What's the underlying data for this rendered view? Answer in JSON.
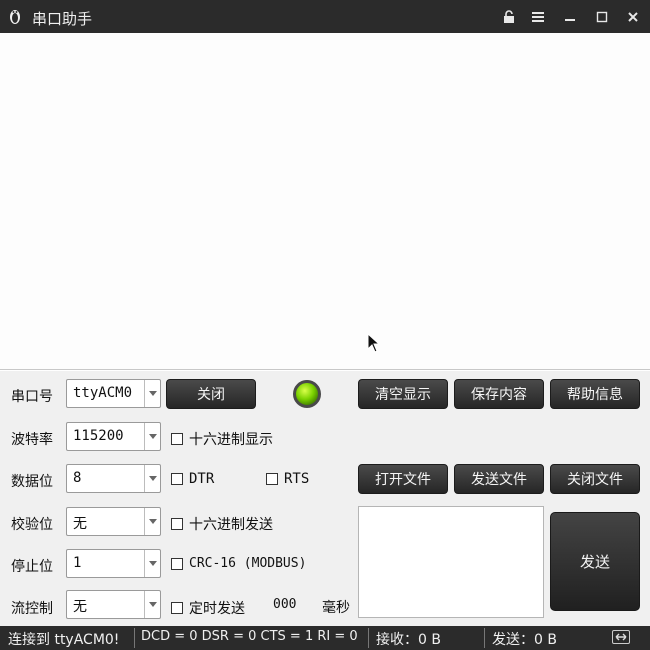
{
  "window": {
    "title": "串口助手"
  },
  "titlebar_icons": [
    "penguin-icon",
    "lock-icon",
    "menu-icon",
    "minimize-icon",
    "maximize-icon",
    "close-icon"
  ],
  "settings": {
    "port": {
      "label": "串口号",
      "value": "ttyACM0"
    },
    "baud": {
      "label": "波特率",
      "value": "115200"
    },
    "databits": {
      "label": "数据位",
      "value": "8"
    },
    "parity": {
      "label": "校验位",
      "value": "无"
    },
    "stopbits": {
      "label": "停止位",
      "value": "1"
    },
    "flow": {
      "label": "流控制",
      "value": "无"
    }
  },
  "buttons": {
    "close_port": "关闭",
    "clear_display": "清空显示",
    "save_content": "保存内容",
    "help_info": "帮助信息",
    "open_file": "打开文件",
    "send_file": "发送文件",
    "close_file": "关闭文件",
    "send": "发送"
  },
  "checkboxes": {
    "hex_display": "十六进制显示",
    "dtr": "DTR",
    "rts": "RTS",
    "hex_send": "十六进制发送",
    "crc16": "CRC-16 (MODBUS)",
    "timed_send": "定时发送"
  },
  "timer": {
    "value": "000",
    "unit": "毫秒"
  },
  "status": {
    "connection": "连接到 ttyACM0!",
    "signals": "DCD = 0 DSR = 0 CTS = 1 RI = 0",
    "received": "接收：0 B",
    "sent": "发送：0 B"
  },
  "colors": {
    "led": "#7ad100",
    "chrome": "#2b2b2b",
    "button": "#333333"
  }
}
